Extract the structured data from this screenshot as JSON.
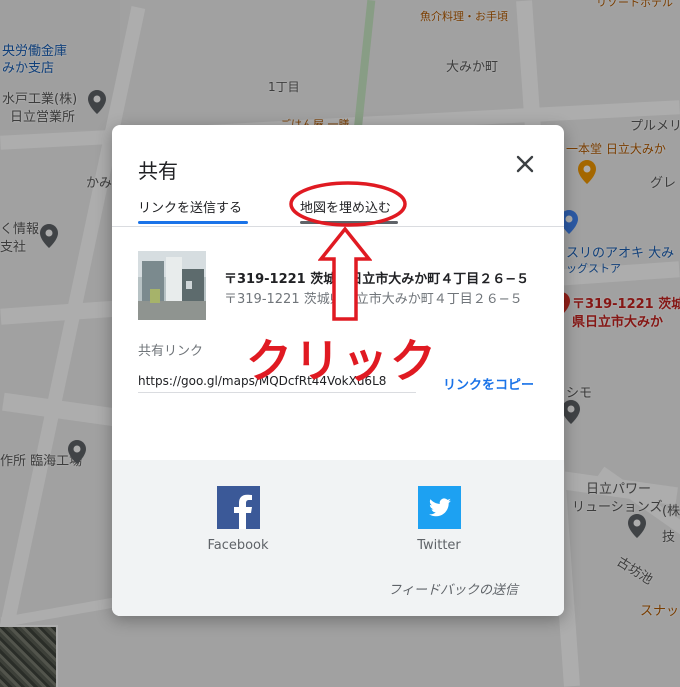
{
  "map": {
    "labels": {
      "top_right_hotel": "リゾートホテル",
      "top_sushi": "魚介料理・お手頃",
      "central_bank": "央労働金庫",
      "mikashiten": "みか支店",
      "mito_kogyo": "水戸工業(株)",
      "hitachi_eigyo": "日立営業所",
      "itchome": "1丁目",
      "omikacho": "大みか町",
      "gohan": "ごはん屋 一膳",
      "purume": "プルメリ",
      "ipponddo": "一本堂 日立大みか",
      "gure": "グレ",
      "kami": "かみ",
      "johou": "く情報",
      "shisha": "支社",
      "aoki": "スリのアオキ 大み",
      "drugstore": "ッグストア",
      "pin_address": "〒319-1221 茨城",
      "pin_address2": "県日立市大みか",
      "shimo": "シモ",
      "rinkai": "作所 臨海工場",
      "power": "日立パワー",
      "solutions": "リューションズ",
      "kobo": "古坊池",
      "snack": "スナッ",
      "ki": "(株",
      "gi": "技"
    }
  },
  "dialog": {
    "title": "共有",
    "tabs": [
      {
        "label": "リンクを送信する",
        "active": true
      },
      {
        "label": "地図を埋め込む",
        "active": false
      }
    ],
    "place": {
      "address_main": "〒319-1221 茨城県日立市大みか町４丁目２６−５",
      "address_sub": "〒319-1221 茨城県日立市大みか町４丁目２６−５"
    },
    "share_link_label": "共有リンク",
    "share_link_value": "https://goo.gl/maps/MQDcfRt44VokXu6L8",
    "copy_link_label": "リンクをコピー",
    "social": [
      {
        "name": "Facebook",
        "icon": "facebook-icon",
        "color": "#3b5998"
      },
      {
        "name": "Twitter",
        "icon": "twitter-icon",
        "color": "#1da1f2"
      }
    ],
    "feedback_label": "フィードバックの送信"
  },
  "annotation": {
    "text": "クリック",
    "color": "#e01a22"
  },
  "colors": {
    "accent": "#1a73e8",
    "annotation": "#e01a22",
    "pin": "#5f6368",
    "pin_red": "#d93025"
  }
}
